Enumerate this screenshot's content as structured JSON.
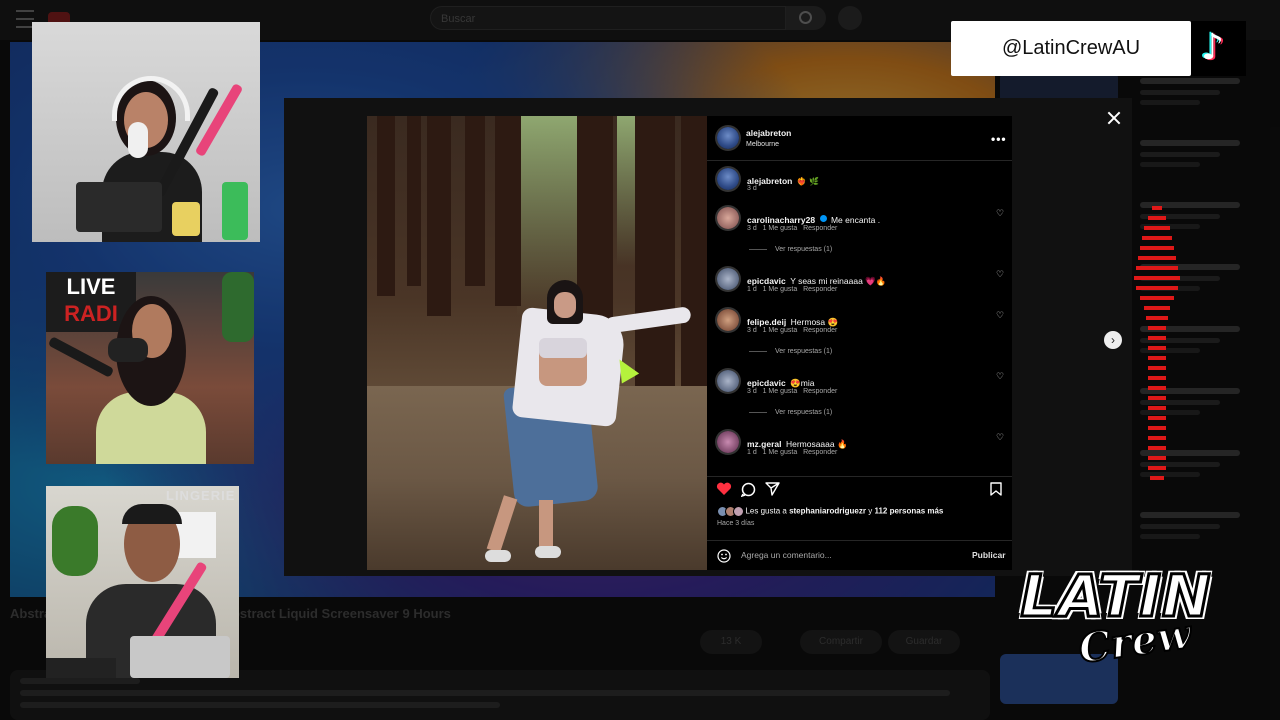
{
  "youtube": {
    "search_placeholder": "Buscar",
    "video_title": "Abstract ... (No Sound) — 4K UHD Abstract Liquid Screensaver 9 Hours",
    "actions": [
      "13 K",
      "Compartir",
      "Guardar"
    ]
  },
  "post": {
    "author": "alejabreton",
    "location": "Melbourne",
    "caption_time": "3 d",
    "caption_emoji": "❤️‍🔥 🌿",
    "likes_prefix": "Les gusta a",
    "likes_user": "stephaniarodriguezr",
    "likes_joiner": "y",
    "likes_count": "112 personas más",
    "posted": "Hace 3 días",
    "comment_placeholder": "Agrega un comentario...",
    "publish_label": "Publicar"
  },
  "comments": [
    {
      "user": "carolinacharry28",
      "text": "Me encanta .",
      "time": "3 d",
      "likes": "1 Me gusta",
      "reply": "Responder",
      "replies": "Ver respuestas (1)",
      "verified": true
    },
    {
      "user": "epicdavic",
      "text": "Y seas mi reinaaaa 💗🔥",
      "time": "1 d",
      "likes": "1 Me gusta",
      "reply": "Responder",
      "replies": ""
    },
    {
      "user": "felipe.deij",
      "text": "Hermosa 😍",
      "time": "3 d",
      "likes": "1 Me gusta",
      "reply": "Responder",
      "replies": "Ver respuestas (1)"
    },
    {
      "user": "epicdavic",
      "text": "😍mia",
      "time": "3 d",
      "likes": "1 Me gusta",
      "reply": "Responder",
      "replies": "Ver respuestas (1)"
    },
    {
      "user": "mz.geral",
      "text": "Hermosaaaa 🔥",
      "time": "1 d",
      "likes": "1 Me gusta",
      "reply": "Responder",
      "replies": ""
    }
  ],
  "overlay": {
    "tiktok_handle": "@LatinCrewAU",
    "logo_line1": "LATIN",
    "logo_line2": "Crew",
    "cam2_sign_line1": "LIVE",
    "cam2_sign_line2": "RADI",
    "cam3_sign": "LINGERIE"
  },
  "colors": {
    "like_red": "#ff3040",
    "meter_red": "#e01818",
    "verified_blue": "#0095f6"
  }
}
